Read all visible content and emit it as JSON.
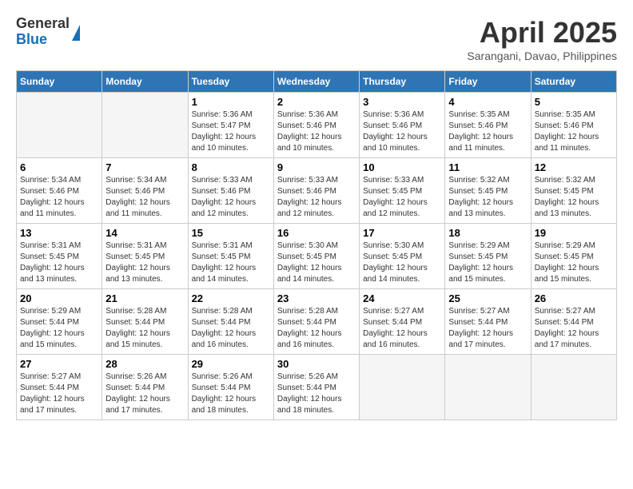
{
  "header": {
    "logo_general": "General",
    "logo_blue": "Blue",
    "month_year": "April 2025",
    "location": "Sarangani, Davao, Philippines"
  },
  "calendar": {
    "days_of_week": [
      "Sunday",
      "Monday",
      "Tuesday",
      "Wednesday",
      "Thursday",
      "Friday",
      "Saturday"
    ],
    "weeks": [
      [
        {
          "day": "",
          "sunrise": "",
          "sunset": "",
          "daylight": ""
        },
        {
          "day": "",
          "sunrise": "",
          "sunset": "",
          "daylight": ""
        },
        {
          "day": "1",
          "sunrise": "Sunrise: 5:36 AM",
          "sunset": "Sunset: 5:47 PM",
          "daylight": "Daylight: 12 hours and 10 minutes."
        },
        {
          "day": "2",
          "sunrise": "Sunrise: 5:36 AM",
          "sunset": "Sunset: 5:46 PM",
          "daylight": "Daylight: 12 hours and 10 minutes."
        },
        {
          "day": "3",
          "sunrise": "Sunrise: 5:36 AM",
          "sunset": "Sunset: 5:46 PM",
          "daylight": "Daylight: 12 hours and 10 minutes."
        },
        {
          "day": "4",
          "sunrise": "Sunrise: 5:35 AM",
          "sunset": "Sunset: 5:46 PM",
          "daylight": "Daylight: 12 hours and 11 minutes."
        },
        {
          "day": "5",
          "sunrise": "Sunrise: 5:35 AM",
          "sunset": "Sunset: 5:46 PM",
          "daylight": "Daylight: 12 hours and 11 minutes."
        }
      ],
      [
        {
          "day": "6",
          "sunrise": "Sunrise: 5:34 AM",
          "sunset": "Sunset: 5:46 PM",
          "daylight": "Daylight: 12 hours and 11 minutes."
        },
        {
          "day": "7",
          "sunrise": "Sunrise: 5:34 AM",
          "sunset": "Sunset: 5:46 PM",
          "daylight": "Daylight: 12 hours and 11 minutes."
        },
        {
          "day": "8",
          "sunrise": "Sunrise: 5:33 AM",
          "sunset": "Sunset: 5:46 PM",
          "daylight": "Daylight: 12 hours and 12 minutes."
        },
        {
          "day": "9",
          "sunrise": "Sunrise: 5:33 AM",
          "sunset": "Sunset: 5:46 PM",
          "daylight": "Daylight: 12 hours and 12 minutes."
        },
        {
          "day": "10",
          "sunrise": "Sunrise: 5:33 AM",
          "sunset": "Sunset: 5:45 PM",
          "daylight": "Daylight: 12 hours and 12 minutes."
        },
        {
          "day": "11",
          "sunrise": "Sunrise: 5:32 AM",
          "sunset": "Sunset: 5:45 PM",
          "daylight": "Daylight: 12 hours and 13 minutes."
        },
        {
          "day": "12",
          "sunrise": "Sunrise: 5:32 AM",
          "sunset": "Sunset: 5:45 PM",
          "daylight": "Daylight: 12 hours and 13 minutes."
        }
      ],
      [
        {
          "day": "13",
          "sunrise": "Sunrise: 5:31 AM",
          "sunset": "Sunset: 5:45 PM",
          "daylight": "Daylight: 12 hours and 13 minutes."
        },
        {
          "day": "14",
          "sunrise": "Sunrise: 5:31 AM",
          "sunset": "Sunset: 5:45 PM",
          "daylight": "Daylight: 12 hours and 13 minutes."
        },
        {
          "day": "15",
          "sunrise": "Sunrise: 5:31 AM",
          "sunset": "Sunset: 5:45 PM",
          "daylight": "Daylight: 12 hours and 14 minutes."
        },
        {
          "day": "16",
          "sunrise": "Sunrise: 5:30 AM",
          "sunset": "Sunset: 5:45 PM",
          "daylight": "Daylight: 12 hours and 14 minutes."
        },
        {
          "day": "17",
          "sunrise": "Sunrise: 5:30 AM",
          "sunset": "Sunset: 5:45 PM",
          "daylight": "Daylight: 12 hours and 14 minutes."
        },
        {
          "day": "18",
          "sunrise": "Sunrise: 5:29 AM",
          "sunset": "Sunset: 5:45 PM",
          "daylight": "Daylight: 12 hours and 15 minutes."
        },
        {
          "day": "19",
          "sunrise": "Sunrise: 5:29 AM",
          "sunset": "Sunset: 5:45 PM",
          "daylight": "Daylight: 12 hours and 15 minutes."
        }
      ],
      [
        {
          "day": "20",
          "sunrise": "Sunrise: 5:29 AM",
          "sunset": "Sunset: 5:44 PM",
          "daylight": "Daylight: 12 hours and 15 minutes."
        },
        {
          "day": "21",
          "sunrise": "Sunrise: 5:28 AM",
          "sunset": "Sunset: 5:44 PM",
          "daylight": "Daylight: 12 hours and 15 minutes."
        },
        {
          "day": "22",
          "sunrise": "Sunrise: 5:28 AM",
          "sunset": "Sunset: 5:44 PM",
          "daylight": "Daylight: 12 hours and 16 minutes."
        },
        {
          "day": "23",
          "sunrise": "Sunrise: 5:28 AM",
          "sunset": "Sunset: 5:44 PM",
          "daylight": "Daylight: 12 hours and 16 minutes."
        },
        {
          "day": "24",
          "sunrise": "Sunrise: 5:27 AM",
          "sunset": "Sunset: 5:44 PM",
          "daylight": "Daylight: 12 hours and 16 minutes."
        },
        {
          "day": "25",
          "sunrise": "Sunrise: 5:27 AM",
          "sunset": "Sunset: 5:44 PM",
          "daylight": "Daylight: 12 hours and 17 minutes."
        },
        {
          "day": "26",
          "sunrise": "Sunrise: 5:27 AM",
          "sunset": "Sunset: 5:44 PM",
          "daylight": "Daylight: 12 hours and 17 minutes."
        }
      ],
      [
        {
          "day": "27",
          "sunrise": "Sunrise: 5:27 AM",
          "sunset": "Sunset: 5:44 PM",
          "daylight": "Daylight: 12 hours and 17 minutes."
        },
        {
          "day": "28",
          "sunrise": "Sunrise: 5:26 AM",
          "sunset": "Sunset: 5:44 PM",
          "daylight": "Daylight: 12 hours and 17 minutes."
        },
        {
          "day": "29",
          "sunrise": "Sunrise: 5:26 AM",
          "sunset": "Sunset: 5:44 PM",
          "daylight": "Daylight: 12 hours and 18 minutes."
        },
        {
          "day": "30",
          "sunrise": "Sunrise: 5:26 AM",
          "sunset": "Sunset: 5:44 PM",
          "daylight": "Daylight: 12 hours and 18 minutes."
        },
        {
          "day": "",
          "sunrise": "",
          "sunset": "",
          "daylight": ""
        },
        {
          "day": "",
          "sunrise": "",
          "sunset": "",
          "daylight": ""
        },
        {
          "day": "",
          "sunrise": "",
          "sunset": "",
          "daylight": ""
        }
      ]
    ]
  }
}
